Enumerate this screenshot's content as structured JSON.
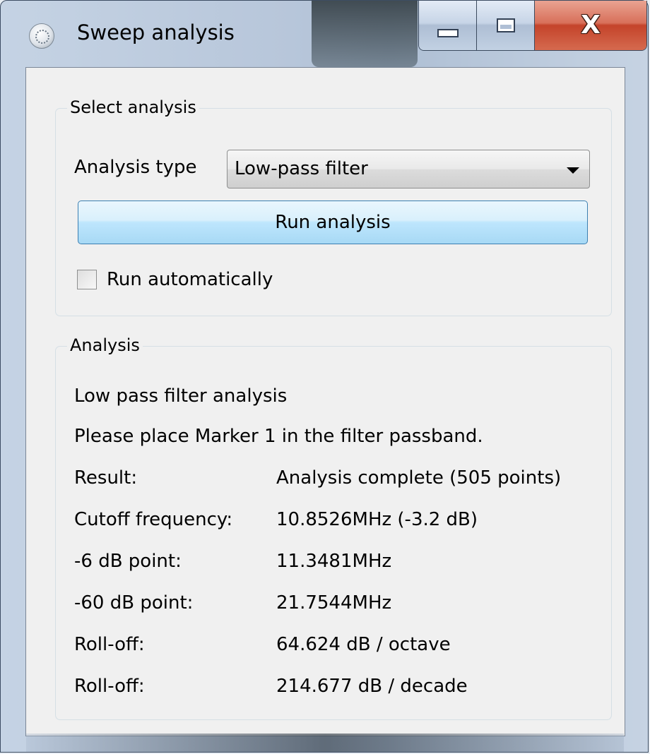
{
  "window": {
    "title": "Sweep analysis",
    "icon": "app-icon",
    "caption_buttons": [
      "minimize-icon",
      "maximize-icon",
      "close-icon"
    ],
    "close_glyph": "X"
  },
  "select_group": {
    "title": "Select analysis",
    "type_label": "Analysis type",
    "type_value": "Low-pass filter",
    "run_button": "Run analysis",
    "auto_label": "Run automatically",
    "auto_checked": false
  },
  "analysis_group": {
    "title": "Analysis",
    "heading": "Low pass filter analysis",
    "instruction": "Please place Marker 1 in the filter passband.",
    "rows": [
      {
        "label": "Result:",
        "value": "Analysis complete (505 points)"
      },
      {
        "label": "Cutoff frequency:",
        "value": "10.8526MHz (-3.2 dB)"
      },
      {
        "label": "-6 dB point:",
        "value": "11.3481MHz"
      },
      {
        "label": "-60 dB point:",
        "value": "21.7544MHz"
      },
      {
        "label": "Roll-off:",
        "value": "64.624 dB / octave"
      },
      {
        "label": "Roll-off:",
        "value": "214.677 dB / decade"
      }
    ]
  }
}
